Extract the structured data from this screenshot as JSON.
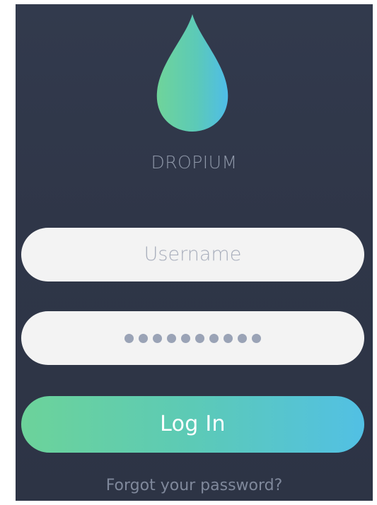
{
  "app": {
    "brand_name": "DROPIUM",
    "logo_icon": "water-drop-icon",
    "accent_gradient": [
      "#6cd39a",
      "#52c0e4"
    ],
    "background_color": "#2f3648"
  },
  "login_form": {
    "username_placeholder": "Username",
    "password_masked_value": "••••••••••",
    "login_button_label": "Log In",
    "forgot_password_link": "Forgot your password?"
  }
}
